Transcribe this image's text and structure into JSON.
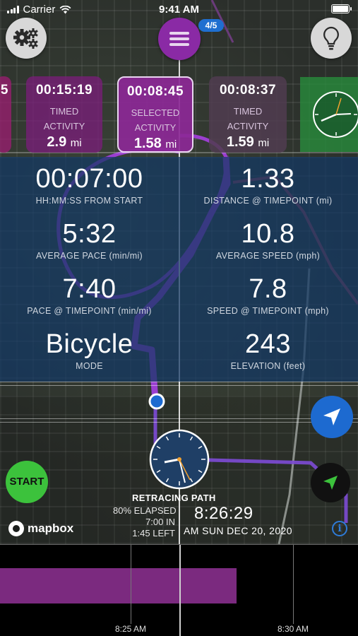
{
  "status_bar": {
    "carrier": "Carrier",
    "time": "9:41 AM"
  },
  "menu": {
    "badge": "4/5"
  },
  "cards": [
    {
      "duration": "00:15:19",
      "line1": "TIMED",
      "line2": "ACTIVITY",
      "distance": "2.9",
      "unit": "mi"
    },
    {
      "duration": "00:08:45",
      "line1": "SELECTED",
      "line2": "ACTIVITY",
      "distance": "1.58",
      "unit": "mi"
    },
    {
      "duration": "00:08:37",
      "line1": "TIMED",
      "line2": "ACTIVITY",
      "distance": "1.59",
      "unit": "mi"
    }
  ],
  "partial_card": {
    "text": "5"
  },
  "stats": {
    "from_start": {
      "value": "00:07:00",
      "label": "HH:MM:SS FROM START"
    },
    "distance": {
      "value": "1.33",
      "label": "DISTANCE @ TIMEPOINT (mi)"
    },
    "avg_pace": {
      "value": "5:32",
      "label": "AVERAGE PACE (min/mi)"
    },
    "avg_speed": {
      "value": "10.8",
      "label": "AVERAGE SPEED (mph)"
    },
    "pace_tp": {
      "value": "7:40",
      "label": "PACE @ TIMEPOINT (min/mi)"
    },
    "speed_tp": {
      "value": "7.8",
      "label": "SPEED @ TIMEPOINT (mph)"
    },
    "mode": {
      "value": "Bicycle",
      "label": "MODE"
    },
    "elevation": {
      "value": "243",
      "label": "ELEVATION (feet)"
    }
  },
  "controls": {
    "start": "START",
    "attribution": "mapbox",
    "info": "i"
  },
  "retrace": {
    "title": "RETRACING PATH",
    "elapsed": "80% ELAPSED",
    "in": "7:00 IN",
    "left": "1:45 LEFT",
    "clock": "8:26:29",
    "date": "AM SUN DEC 20, 2020"
  },
  "timeline": {
    "labels": [
      "8:25 AM",
      "8:30 AM"
    ],
    "progress": 0.66
  },
  "colors": {
    "route": "#9b3fd0",
    "accent_blue": "#1d6ad0",
    "start_green": "#3cc23c",
    "activity_purple": "#7b2a7f"
  },
  "icons": [
    "wifi-icon",
    "battery-icon",
    "gear-icon",
    "menu-icon",
    "lightbulb-icon",
    "clock-icon",
    "location-arrow-icon",
    "navigation-arrow-icon",
    "info-icon",
    "mapbox-logo-icon"
  ]
}
